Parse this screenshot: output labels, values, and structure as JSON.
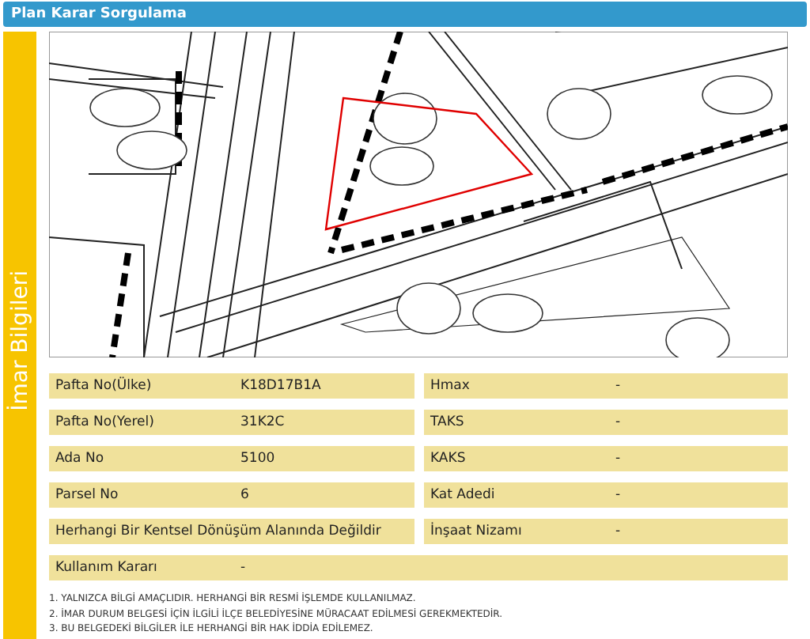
{
  "header": {
    "title": "Plan Karar Sorgulama"
  },
  "side_tab": {
    "label": "İmar Bilgileri"
  },
  "rows": [
    [
      {
        "label": "Pafta No(Ülke)",
        "value": "K18D17B1A"
      },
      {
        "label": "Hmax",
        "value": "-"
      }
    ],
    [
      {
        "label": "Pafta No(Yerel)",
        "value": "31K2C"
      },
      {
        "label": "TAKS",
        "value": "-"
      }
    ],
    [
      {
        "label": "Ada No",
        "value": "5100"
      },
      {
        "label": "KAKS",
        "value": "-"
      }
    ],
    [
      {
        "label": "Parsel No",
        "value": "6"
      },
      {
        "label": "Kat Adedi",
        "value": "-"
      }
    ],
    [
      {
        "label": "Herhangi Bir Kentsel Dönüşüm Alanında Değildir"
      },
      {
        "label": "İnşaat Nizamı",
        "value": "-"
      }
    ],
    [
      {
        "label": "Kullanım Kararı",
        "value": "-"
      }
    ]
  ],
  "notes": [
    "1. YALNIZCA BİLGİ AMAÇLIDIR. HERHANGİ BİR RESMİ İŞLEMDE KULLANILMAZ.",
    "2. İMAR DURUM BELGESİ İÇİN İLGİLİ İLÇE BELEDİYESİNE MÜRACAAT EDİLMESİ GEREKMEKTEDİR.",
    "3. BU BELGEDEKİ BİLGİLER İLE HERHANGİ BİR HAK İDDİA EDİLEMEZ."
  ]
}
